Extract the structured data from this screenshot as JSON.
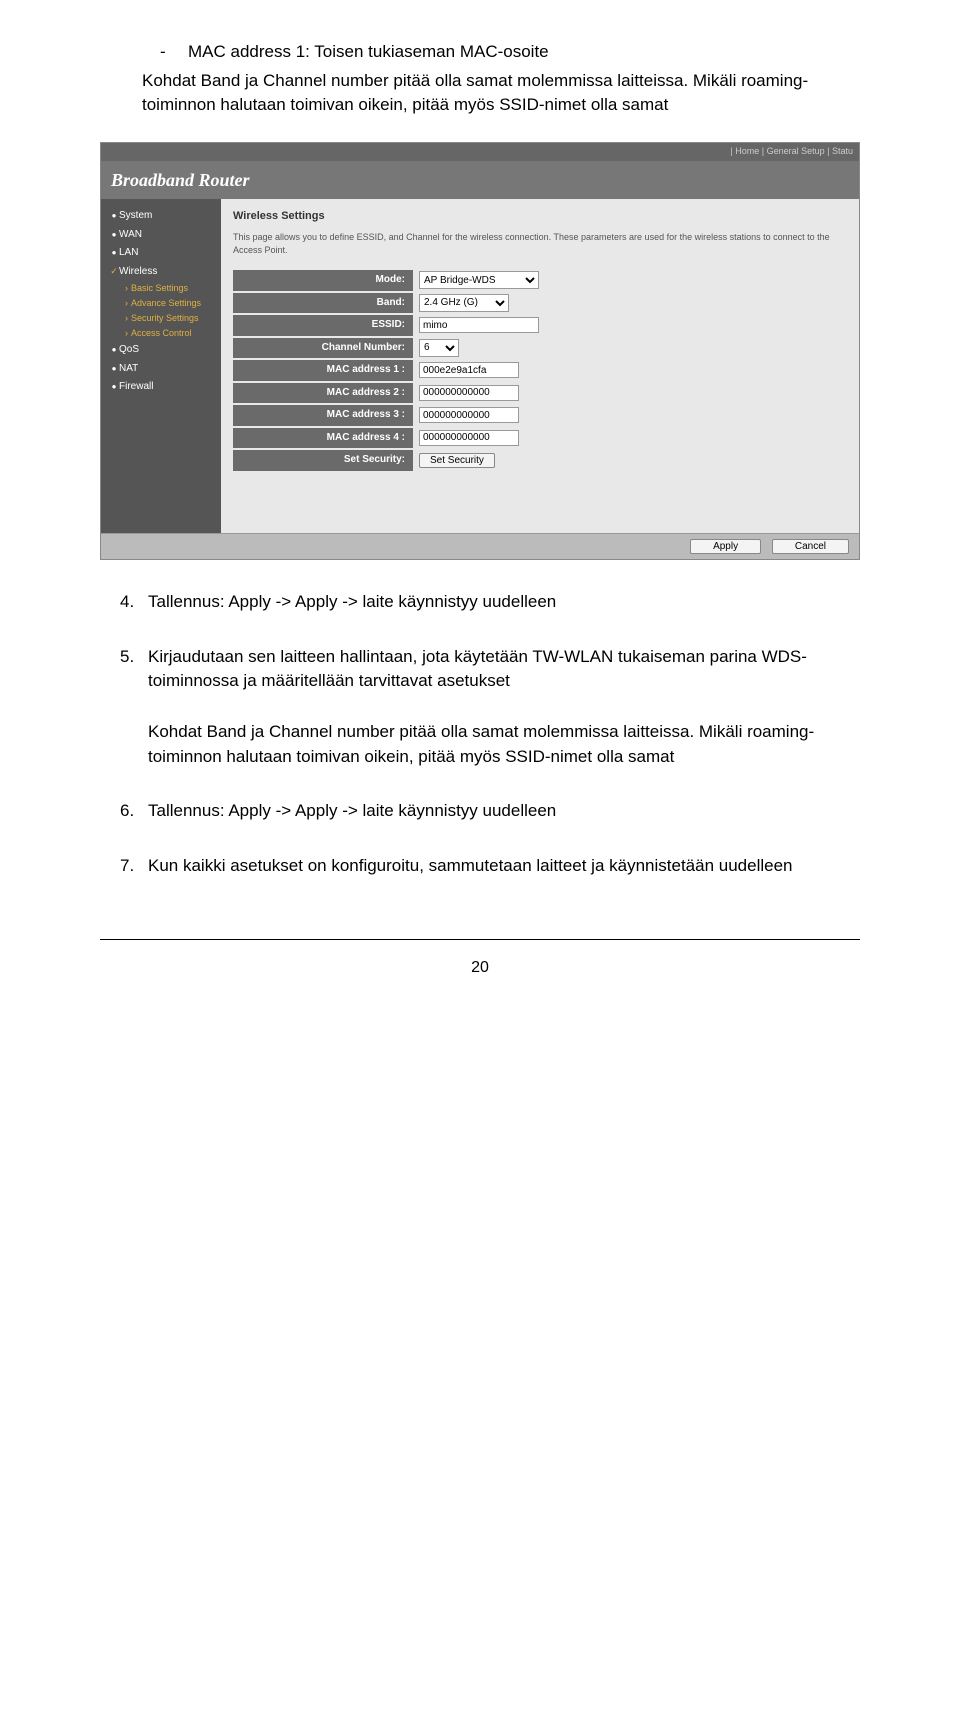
{
  "doc": {
    "bullet_dash": "-",
    "bullet_text": "MAC address 1: Toisen tukiaseman MAC-osoite",
    "indent_para": "Kohdat Band ja Channel number pitää olla samat molemmissa laitteissa. Mikäli roaming-toiminnon halutaan toimivan oikein, pitää myös SSID-nimet olla samat"
  },
  "router": {
    "toplinks": "| Home | General Setup | Statu",
    "brand": "Broadband Router",
    "sidebar": {
      "items": [
        {
          "label": "System"
        },
        {
          "label": "WAN"
        },
        {
          "label": "LAN"
        },
        {
          "label": "Wireless",
          "active": true,
          "subs": [
            "Basic Settings",
            "Advance Settings",
            "Security Settings",
            "Access Control"
          ]
        },
        {
          "label": "QoS"
        },
        {
          "label": "NAT"
        },
        {
          "label": "Firewall"
        }
      ]
    },
    "content": {
      "title": "Wireless Settings",
      "desc": "This page allows you to define ESSID, and Channel for the wireless connection. These parameters are used for the wireless stations to connect to the Access Point.",
      "mode_label": "Mode:",
      "mode_value": "AP Bridge-WDS",
      "band_label": "Band:",
      "band_value": "2.4 GHz (G)",
      "essid_label": "ESSID:",
      "essid_value": "mimo",
      "chan_label": "Channel Number:",
      "chan_value": "6",
      "mac1_label": "MAC address 1 :",
      "mac1_value": "000e2e9a1cfa",
      "mac2_label": "MAC address 2 :",
      "mac2_value": "000000000000",
      "mac3_label": "MAC address 3 :",
      "mac3_value": "000000000000",
      "mac4_label": "MAC address 4 :",
      "mac4_value": "000000000000",
      "sec_label": "Set Security:",
      "sec_button": "Set Security",
      "apply": "Apply",
      "cancel": "Cancel"
    }
  },
  "list": {
    "n4": "4.",
    "t4": "Tallennus: Apply -> Apply -> laite käynnistyy uudelleen",
    "n5": "5.",
    "t5a": "Kirjaudutaan sen laitteen hallintaan, jota käytetään TW-WLAN tukaiseman parina WDS-toiminnossa ja määritellään tarvittavat asetukset",
    "t5b": "Kohdat Band ja Channel number pitää olla samat molemmissa laitteissa. Mikäli roaming-toiminnon halutaan toimivan oikein, pitää myös SSID-nimet olla samat",
    "n6": "6.",
    "t6": "Tallennus: Apply -> Apply -> laite käynnistyy uudelleen",
    "n7": "7.",
    "t7": "Kun kaikki asetukset on konfiguroitu, sammutetaan laitteet ja käynnistetään uudelleen"
  },
  "page_number": "20"
}
